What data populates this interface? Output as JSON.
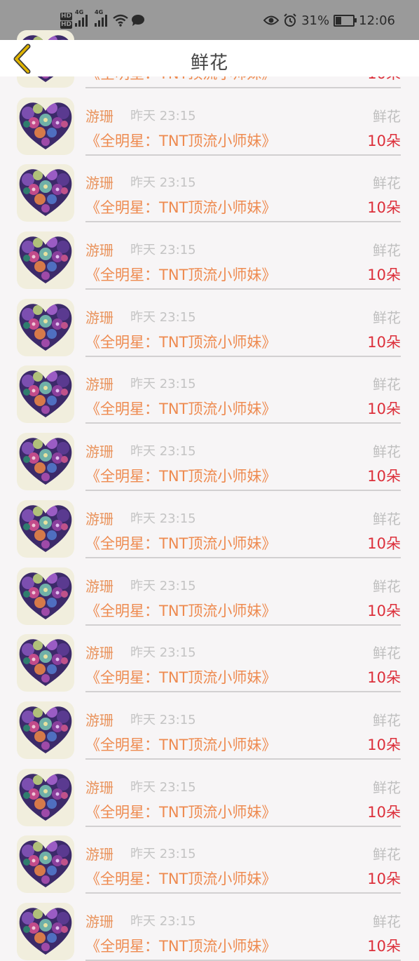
{
  "status_bar": {
    "hd1": "HD",
    "hd2": "HD",
    "net1": "4G",
    "net2": "4G",
    "battery_text": "31%",
    "battery_level": 0.31,
    "time": "12:06",
    "icons": [
      "signal-icon",
      "wifi-icon",
      "chat-bubble-icon",
      "eye-icon",
      "alarm-icon",
      "battery-icon"
    ]
  },
  "header": {
    "title": "鲜花",
    "back_icon": "chevron-left-icon",
    "accent": "#e0b400"
  },
  "colors": {
    "name": "#e9935c",
    "time": "#c4c4c4",
    "type": "#bfbfbf",
    "book": "#ee8a4f",
    "count": "#dc2f3a"
  },
  "items": [
    {
      "name": "游珊",
      "time": "昨天 23:15",
      "type": "鲜花",
      "book": "《全明星：TNT顶流小师妹》",
      "count": "10朵"
    },
    {
      "name": "游珊",
      "time": "昨天 23:15",
      "type": "鲜花",
      "book": "《全明星：TNT顶流小师妹》",
      "count": "10朵"
    },
    {
      "name": "游珊",
      "time": "昨天 23:15",
      "type": "鲜花",
      "book": "《全明星：TNT顶流小师妹》",
      "count": "10朵"
    },
    {
      "name": "游珊",
      "time": "昨天 23:15",
      "type": "鲜花",
      "book": "《全明星：TNT顶流小师妹》",
      "count": "10朵"
    },
    {
      "name": "游珊",
      "time": "昨天 23:15",
      "type": "鲜花",
      "book": "《全明星：TNT顶流小师妹》",
      "count": "10朵"
    },
    {
      "name": "游珊",
      "time": "昨天 23:15",
      "type": "鲜花",
      "book": "《全明星：TNT顶流小师妹》",
      "count": "10朵"
    },
    {
      "name": "游珊",
      "time": "昨天 23:15",
      "type": "鲜花",
      "book": "《全明星：TNT顶流小师妹》",
      "count": "10朵"
    },
    {
      "name": "游珊",
      "time": "昨天 23:15",
      "type": "鲜花",
      "book": "《全明星：TNT顶流小师妹》",
      "count": "10朵"
    },
    {
      "name": "游珊",
      "time": "昨天 23:15",
      "type": "鲜花",
      "book": "《全明星：TNT顶流小师妹》",
      "count": "10朵"
    },
    {
      "name": "游珊",
      "time": "昨天 23:15",
      "type": "鲜花",
      "book": "《全明星：TNT顶流小师妹》",
      "count": "10朵"
    },
    {
      "name": "游珊",
      "time": "昨天 23:15",
      "type": "鲜花",
      "book": "《全明星：TNT顶流小师妹》",
      "count": "10朵"
    },
    {
      "name": "游珊",
      "time": "昨天 23:15",
      "type": "鲜花",
      "book": "《全明星：TNT顶流小师妹》",
      "count": "10朵"
    },
    {
      "name": "游珊",
      "time": "昨天 23:15",
      "type": "鲜花",
      "book": "《全明星：TNT顶流小师妹》",
      "count": "10朵"
    },
    {
      "name": "游珊",
      "time": "昨天 23:15",
      "type": "鲜花",
      "book": "《全明星：TNT顶流小师妹》",
      "count": "10朵"
    }
  ]
}
